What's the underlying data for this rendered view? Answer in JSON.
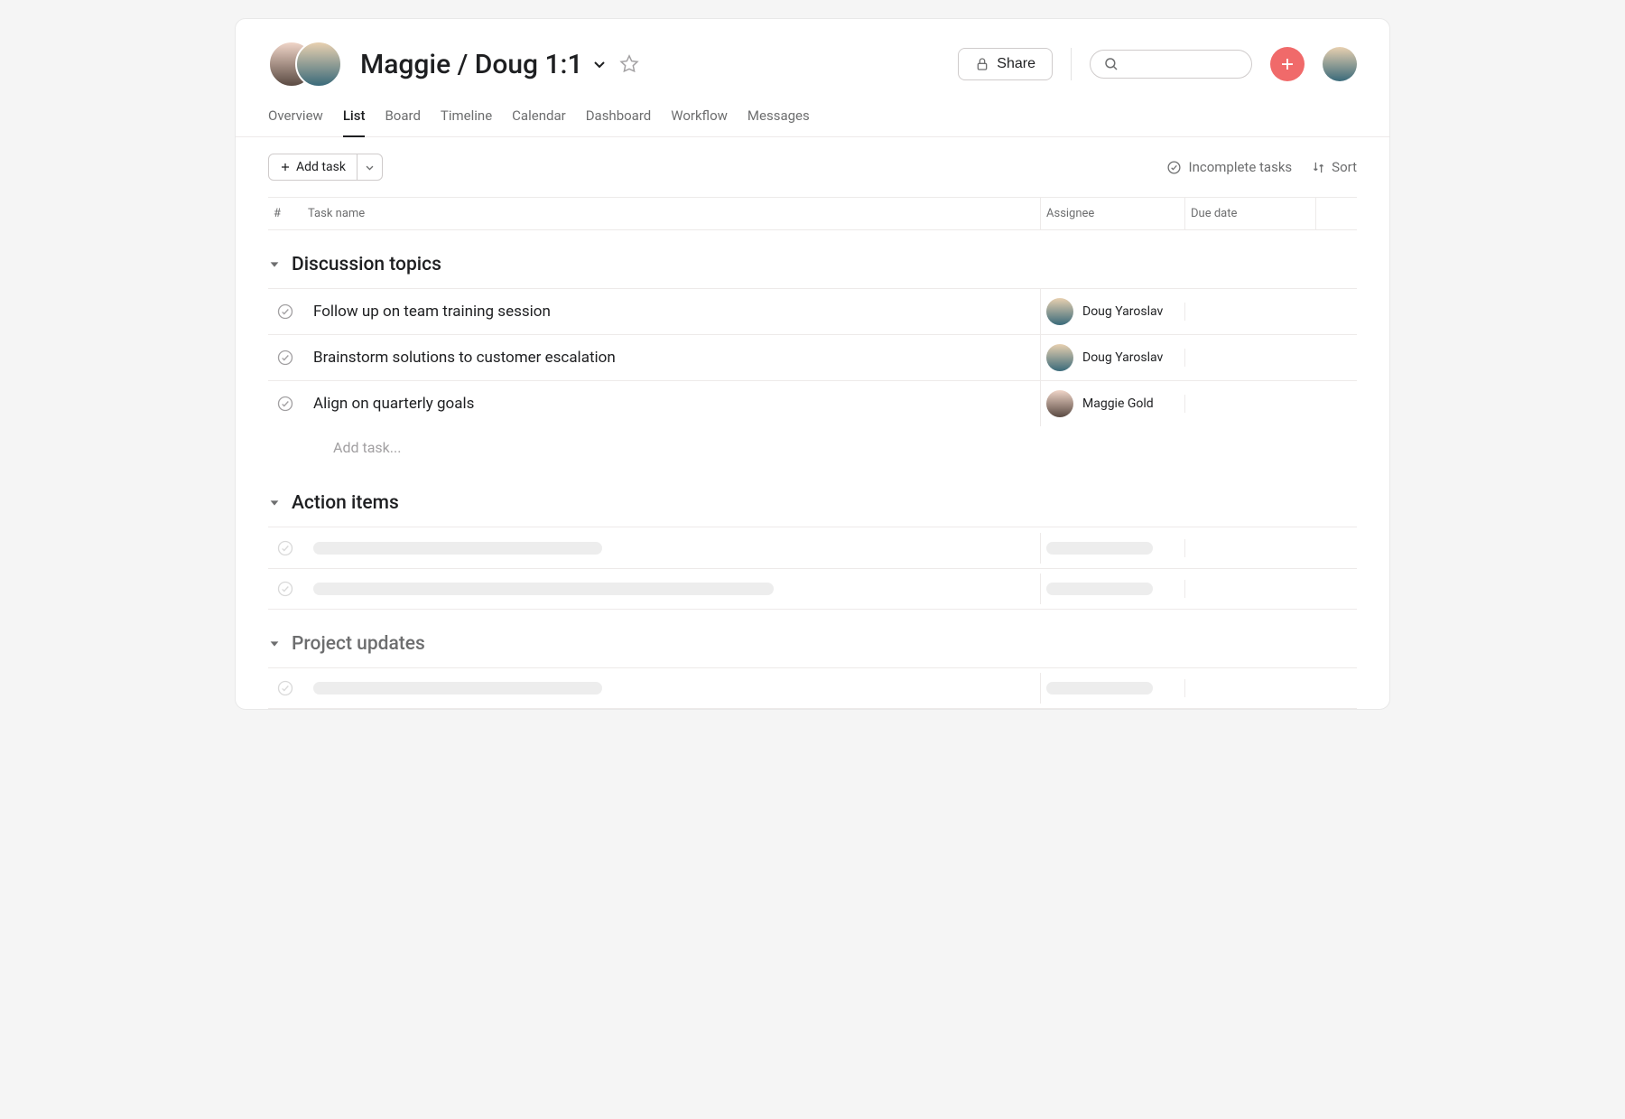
{
  "header": {
    "title": "Maggie / Doug 1:1",
    "share_label": "Share",
    "search_placeholder": ""
  },
  "tabs": [
    {
      "label": "Overview",
      "active": false
    },
    {
      "label": "List",
      "active": true
    },
    {
      "label": "Board",
      "active": false
    },
    {
      "label": "Timeline",
      "active": false
    },
    {
      "label": "Calendar",
      "active": false
    },
    {
      "label": "Dashboard",
      "active": false
    },
    {
      "label": "Workflow",
      "active": false
    },
    {
      "label": "Messages",
      "active": false
    }
  ],
  "toolbar": {
    "add_task_label": "Add task",
    "filter_label": "Incomplete tasks",
    "sort_label": "Sort"
  },
  "columns": {
    "hash": "#",
    "name": "Task name",
    "assignee": "Assignee",
    "due": "Due date"
  },
  "sections": [
    {
      "title": "Discussion topics",
      "tasks": [
        {
          "name": "Follow up on team training session",
          "assignee": "Doug Yaroslav",
          "assignee_key": "doug"
        },
        {
          "name": "Brainstorm solutions to customer escalation",
          "assignee": "Doug Yaroslav",
          "assignee_key": "doug"
        },
        {
          "name": "Align on quarterly goals",
          "assignee": "Maggie Gold",
          "assignee_key": "maggie"
        }
      ],
      "add_placeholder": "Add task..."
    },
    {
      "title": "Action items",
      "skeleton_rows": 2
    },
    {
      "title": "Project updates",
      "skeleton_rows": 1,
      "dim": true
    }
  ]
}
